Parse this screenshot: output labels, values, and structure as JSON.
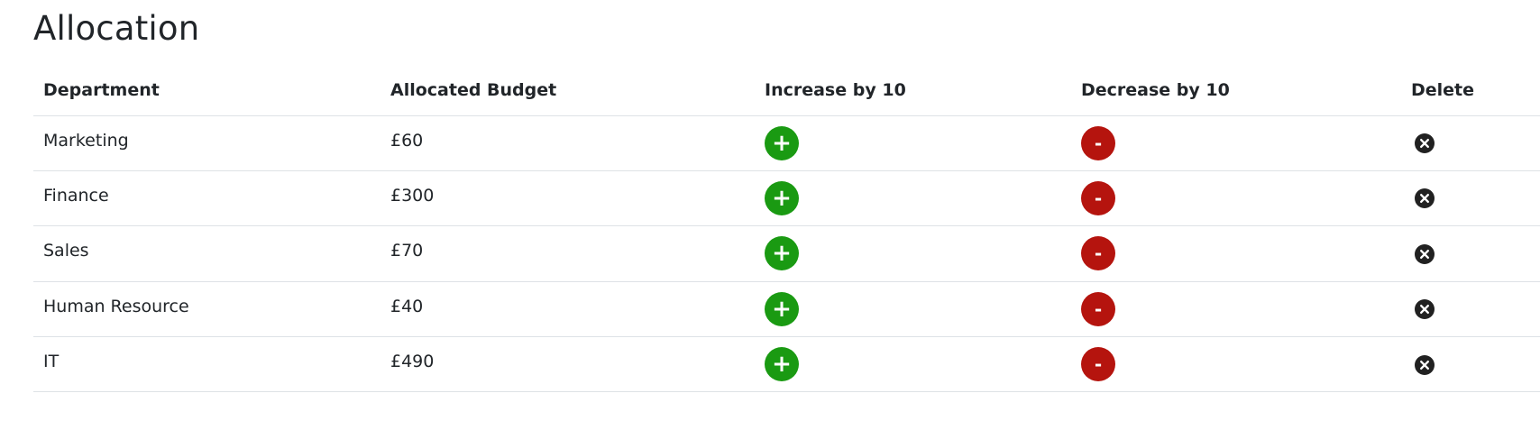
{
  "page": {
    "title": "Allocation"
  },
  "table": {
    "headers": [
      "Department",
      "Allocated Budget",
      "Increase by 10",
      "Decrease by 10",
      "Delete"
    ],
    "rows": [
      {
        "department": "Marketing",
        "budget": "£60"
      },
      {
        "department": "Finance",
        "budget": "£300"
      },
      {
        "department": "Sales",
        "budget": "£70"
      },
      {
        "department": "Human Resource",
        "budget": "£40"
      },
      {
        "department": "IT",
        "budget": "£490"
      }
    ],
    "increase_symbol": "+",
    "decrease_symbol": "-",
    "delete_icon": "circle-x-icon"
  },
  "colors": {
    "increase": "#1a9a12",
    "decrease": "#b5140e",
    "delete": "#212121"
  }
}
